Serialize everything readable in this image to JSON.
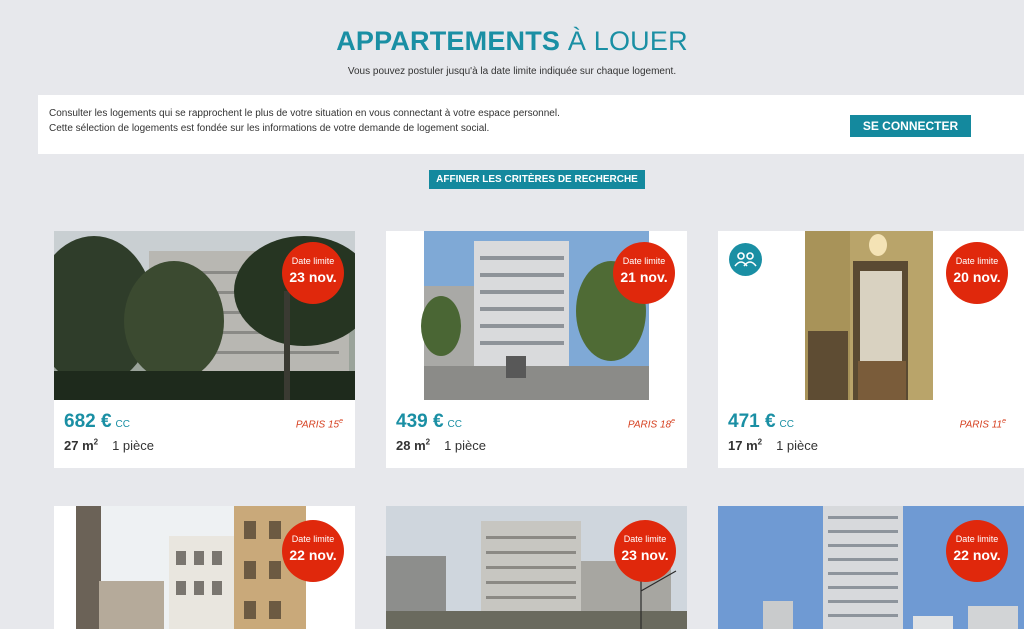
{
  "header": {
    "title_strong": "APPARTEMENTS",
    "title_light": " À LOUER",
    "subtitle": "Vous pouvez postuler jusqu'à la date limite indiquée sur chaque logement."
  },
  "login_panel": {
    "line1": "Consulter les logements qui se rapprochent le plus de votre situation en vous connectant à votre espace personnel.",
    "line2": "Cette sélection de logements est fondée sur les informations de votre demande de logement social.",
    "button_label": "SE CONNECTER"
  },
  "refine_button": "AFFINER LES CRITÈRES DE RECHERCHE",
  "listings": [
    {
      "badge_label": "Date limite",
      "deadline": "23 nov.",
      "price": "682 €",
      "price_suffix": "CC",
      "city": "PARIS 15",
      "arr_suffix": "e",
      "surface": "27 m",
      "surface_sup": "2",
      "rooms": "1 pièce"
    },
    {
      "badge_label": "Date limite",
      "deadline": "21 nov.",
      "price": "439 €",
      "price_suffix": "CC",
      "city": "PARIS 18",
      "arr_suffix": "e",
      "surface": "28 m",
      "surface_sup": "2",
      "rooms": "1 pièce"
    },
    {
      "badge_label": "Date limite",
      "deadline": "20 nov.",
      "price": "471 €",
      "price_suffix": "CC",
      "city": "PARIS 11",
      "arr_suffix": "e",
      "surface": "17 m",
      "surface_sup": "2",
      "rooms": "1 pièce",
      "icon": "shared-housing-icon"
    },
    {
      "badge_label": "Date limite",
      "deadline": "22 nov."
    },
    {
      "badge_label": "Date limite",
      "deadline": "23 nov."
    },
    {
      "badge_label": "Date limite",
      "deadline": "22 nov."
    }
  ],
  "colors": {
    "background": "#e7e8ec",
    "teal": "#1a8fa4",
    "button_teal": "#14899e",
    "badge_red": "#e0280c",
    "location_red": "#d64020"
  }
}
